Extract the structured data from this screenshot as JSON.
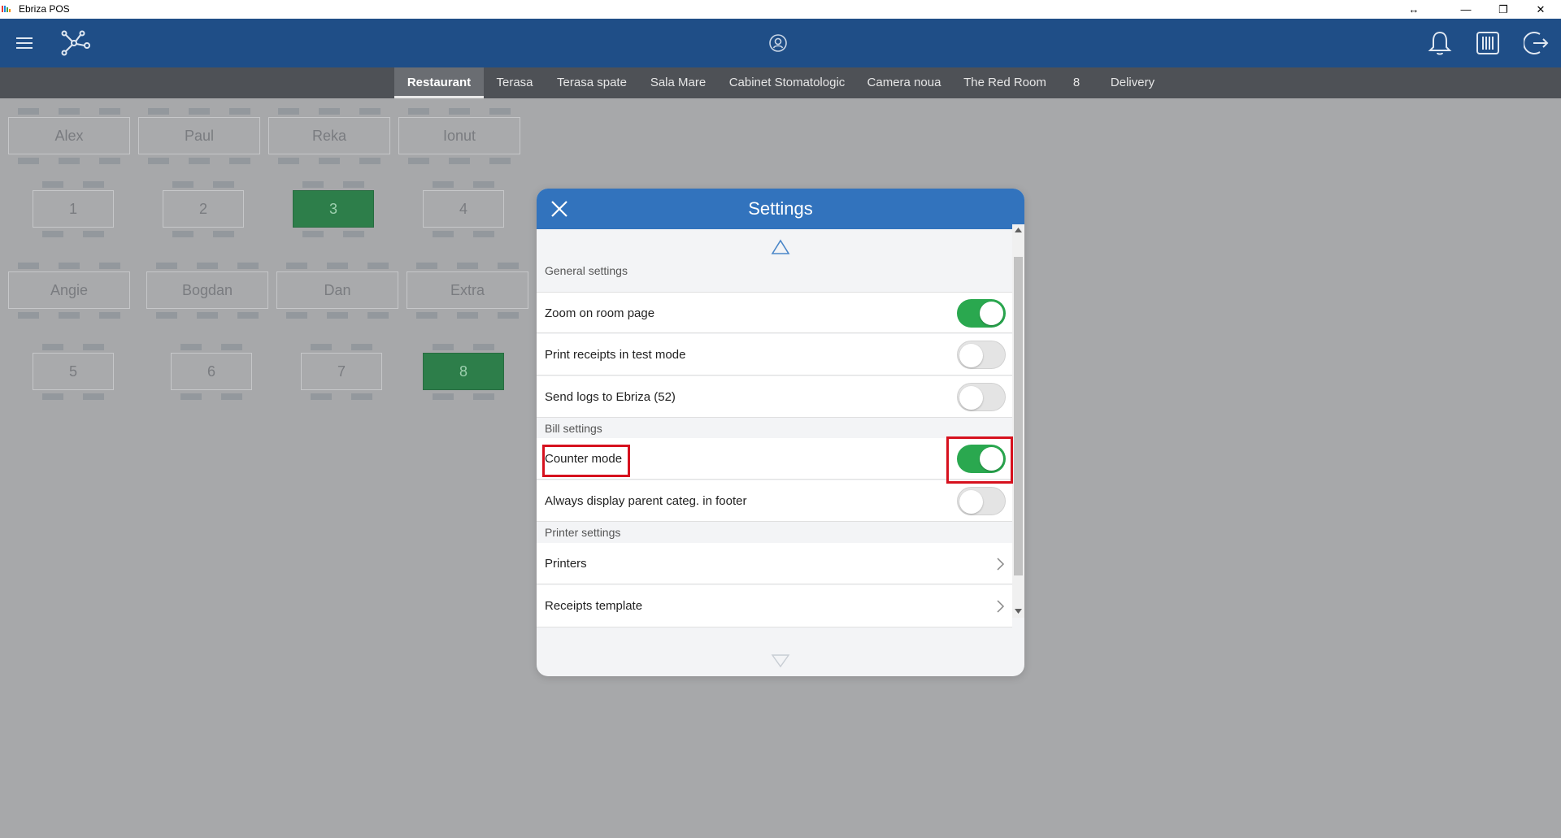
{
  "window": {
    "title": "Ebriza POS",
    "controls": {
      "resize": "↔",
      "minimize": "—",
      "restore": "❐",
      "close": "✕"
    }
  },
  "header": {
    "icons": [
      "menu-icon",
      "network-icon",
      "user-badge-icon",
      "bell-icon",
      "cash-register-icon",
      "logout-icon"
    ]
  },
  "tabs": [
    {
      "label": "Restaurant",
      "active": true
    },
    {
      "label": "Terasa"
    },
    {
      "label": "Terasa spate"
    },
    {
      "label": "Sala Mare"
    },
    {
      "label": "Cabinet Stomatologic"
    },
    {
      "label": "Camera noua"
    },
    {
      "label": "The Red Room"
    },
    {
      "label": "8"
    },
    {
      "label": "Delivery"
    }
  ],
  "tables": {
    "row1": [
      "Alex",
      "Paul",
      "Reka",
      "Ionut"
    ],
    "row2": [
      "1",
      "2",
      "3",
      "4"
    ],
    "row3": [
      "Angie",
      "Bogdan",
      "Dan",
      "Extra"
    ],
    "row4": [
      "5",
      "6",
      "7",
      "8"
    ],
    "occupied": [
      "3",
      "8"
    ]
  },
  "settings": {
    "title": "Settings",
    "sections": {
      "general": "General settings",
      "bill": "Bill settings",
      "printer": "Printer settings"
    },
    "items": {
      "zoom": {
        "label": "Zoom on room page",
        "on": true
      },
      "test_mode": {
        "label": "Print receipts in test mode",
        "on": false
      },
      "send_logs": {
        "label": "Send logs to Ebriza (52)",
        "on": false
      },
      "counter_mode": {
        "label": "Counter mode",
        "on": true
      },
      "parent_categ": {
        "label": "Always display parent categ. in footer",
        "on": false
      },
      "printers": {
        "label": "Printers"
      },
      "receipts_template": {
        "label": "Receipts template"
      }
    }
  },
  "colors": {
    "header": "#1f4e87",
    "dialog_header": "#3273bd",
    "toggle_on": "#2aa84f",
    "occupied_table": "#2d7e4a",
    "highlight": "#d6111e"
  }
}
